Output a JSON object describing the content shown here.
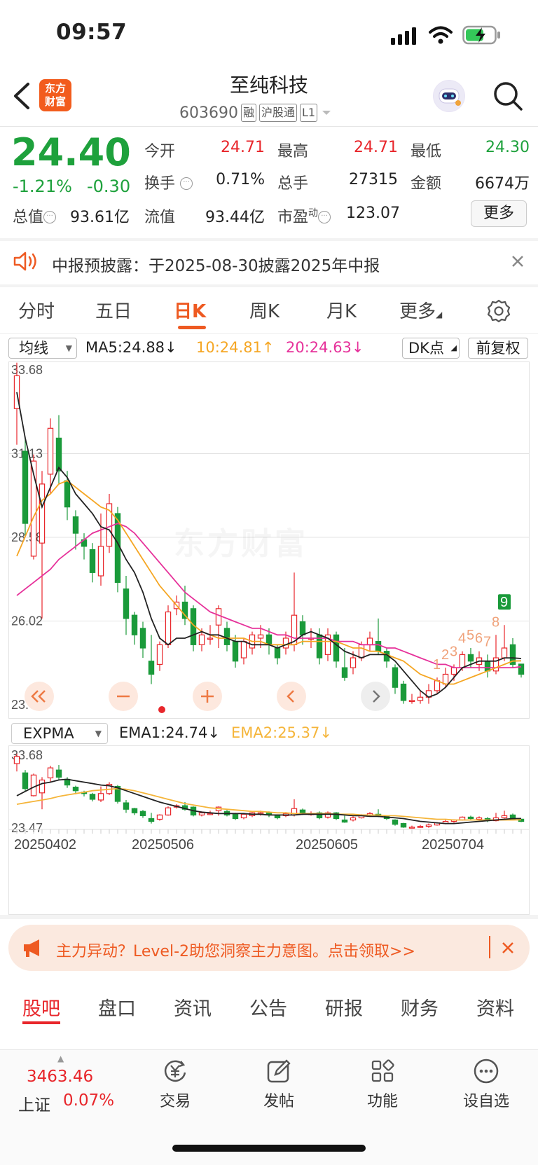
{
  "status": {
    "time": "09:57"
  },
  "header": {
    "logo_line1": "东方",
    "logo_line2": "财富",
    "stock_name": "至纯科技",
    "stock_code": "603690",
    "tags": [
      "融",
      "沪股通",
      "L1"
    ]
  },
  "quote": {
    "price": "24.40",
    "change_pct": "-1.21%",
    "change_abs": "-0.30",
    "rows": [
      [
        {
          "label": "今开",
          "value": "24.71",
          "color": "red"
        },
        {
          "label": "最高",
          "value": "24.71",
          "color": "red"
        },
        {
          "label": "最低",
          "value": "24.30",
          "color": "green"
        }
      ],
      [
        {
          "label": "换手",
          "value": "0.71%",
          "color": "dark"
        },
        {
          "label": "总手",
          "value": "27315",
          "color": "dark"
        },
        {
          "label": "金额",
          "value": "6674万",
          "color": "dark"
        }
      ]
    ],
    "total_value_label": "总值",
    "total_value": "93.61亿",
    "float_value_label": "流值",
    "float_value": "93.44亿",
    "pe_label": "市盈",
    "pe_sup": "动",
    "pe_value": "123.07",
    "more_label": "更多"
  },
  "notice": {
    "text": "中报预披露：于2025-08-30披露2025年中报"
  },
  "tabs": [
    "分时",
    "五日",
    "日K",
    "周K",
    "月K",
    "更多"
  ],
  "active_tab": "日K",
  "main_indicator": {
    "selector": "均线",
    "ma5": "MA5:24.88",
    "ma10": "10:24.81",
    "ma20": "20:24.63",
    "dk": "DK点",
    "adjust": "前复权"
  },
  "sub_indicator": {
    "selector": "EXPMA",
    "ema1": "EMA1:24.74",
    "ema2": "EMA2:25.37"
  },
  "chart_data": {
    "type": "candlestick",
    "main_ylabels": [
      "33.68",
      "31.13",
      "28.58",
      "26.02",
      "23.47"
    ],
    "main_ylim": [
      23.47,
      33.68
    ],
    "sub_ylabels": [
      "33.68",
      "23.47"
    ],
    "xlabels": [
      "20250402",
      "20250506",
      "20250605",
      "20250704"
    ],
    "sequence_labels": [
      "1",
      "2",
      "3",
      "4",
      "5",
      "6",
      "7",
      "8",
      "9"
    ],
    "colors": {
      "up": "#e8262b",
      "down": "#1a9a3a",
      "ma5": "#222222",
      "ma10": "#f5a623",
      "ma20": "#e6319a",
      "ema1": "#222222",
      "ema2": "#f5b53a"
    },
    "candles": [
      [
        32.5,
        33.5,
        31.4,
        33.9
      ],
      [
        31.2,
        29.0,
        28.6,
        31.6
      ],
      [
        28.0,
        30.9,
        27.9,
        31.1
      ],
      [
        28.4,
        30.2,
        26.1,
        30.6
      ],
      [
        30.5,
        31.9,
        29.9,
        32.2
      ],
      [
        31.6,
        30.6,
        30.2,
        32.3
      ],
      [
        30.3,
        29.5,
        29.1,
        30.6
      ],
      [
        29.2,
        28.7,
        28.2,
        29.4
      ],
      [
        28.5,
        28.3,
        27.9,
        28.7
      ],
      [
        28.2,
        27.5,
        27.2,
        28.4
      ],
      [
        27.4,
        28.3,
        27.1,
        29.3
      ],
      [
        28.3,
        29.6,
        28.1,
        29.9
      ],
      [
        29.3,
        27.2,
        26.9,
        29.5
      ],
      [
        27.0,
        26.1,
        25.6,
        27.4
      ],
      [
        26.2,
        25.6,
        25.3,
        26.3
      ],
      [
        25.8,
        25.2,
        24.9,
        26.0
      ],
      [
        24.8,
        24.4,
        24.1,
        25.6
      ],
      [
        24.7,
        25.3,
        24.5,
        25.4
      ],
      [
        25.3,
        26.3,
        25.2,
        26.5
      ],
      [
        26.4,
        26.6,
        26.2,
        26.8
      ],
      [
        26.6,
        26.1,
        25.9,
        27.1
      ],
      [
        26.4,
        25.3,
        25.1,
        26.5
      ],
      [
        25.3,
        25.6,
        25.1,
        25.8
      ],
      [
        25.5,
        25.5,
        25.3,
        25.9
      ],
      [
        25.9,
        26.4,
        25.2,
        26.5
      ],
      [
        25.8,
        25.3,
        25.1,
        26.0
      ],
      [
        25.4,
        24.8,
        24.6,
        25.6
      ],
      [
        24.9,
        25.4,
        24.7,
        25.5
      ],
      [
        25.2,
        25.6,
        25.0,
        25.7
      ],
      [
        25.5,
        25.6,
        25.2,
        25.9
      ],
      [
        25.6,
        25.3,
        25.0,
        25.8
      ],
      [
        25.2,
        24.9,
        24.7,
        25.3
      ],
      [
        25.2,
        25.5,
        25.0,
        25.7
      ],
      [
        25.3,
        26.2,
        25.1,
        27.5
      ],
      [
        26.0,
        25.6,
        25.3,
        26.2
      ],
      [
        25.5,
        25.5,
        25.2,
        25.8
      ],
      [
        25.6,
        24.9,
        24.7,
        25.8
      ],
      [
        25.0,
        25.6,
        24.8,
        25.8
      ],
      [
        25.6,
        24.8,
        24.6,
        25.7
      ],
      [
        24.6,
        24.3,
        24.2,
        25.2
      ],
      [
        24.6,
        24.9,
        24.4,
        25.1
      ],
      [
        24.9,
        25.3,
        24.8,
        25.4
      ],
      [
        25.3,
        25.5,
        25.1,
        25.7
      ],
      [
        25.4,
        25.1,
        25.0,
        26.1
      ],
      [
        25.1,
        24.8,
        24.6,
        25.2
      ],
      [
        24.6,
        24.0,
        23.8,
        24.7
      ],
      [
        24.1,
        23.6,
        23.5,
        24.2
      ],
      [
        23.6,
        23.6,
        23.5,
        23.8
      ],
      [
        23.6,
        23.7,
        23.5,
        23.9
      ],
      [
        23.7,
        23.9,
        23.5,
        24.1
      ],
      [
        23.9,
        24.2,
        23.8,
        24.3
      ],
      [
        24.1,
        24.4,
        24.0,
        24.6
      ],
      [
        24.4,
        24.6,
        24.2,
        24.7
      ],
      [
        24.6,
        25.0,
        24.5,
        25.1
      ],
      [
        25.0,
        24.8,
        24.6,
        25.2
      ],
      [
        24.7,
        24.9,
        24.5,
        25.1
      ],
      [
        24.8,
        24.5,
        24.3,
        25.0
      ],
      [
        24.5,
        24.9,
        24.4,
        25.6
      ],
      [
        24.9,
        25.2,
        24.8,
        25.9
      ],
      [
        25.3,
        24.7,
        24.6,
        25.5
      ],
      [
        24.71,
        24.4,
        24.3,
        24.71
      ]
    ],
    "ma5": [
      33.0,
      31.6,
      30.5,
      29.5,
      30.1,
      30.7,
      30.4,
      29.9,
      29.6,
      29.3,
      28.9,
      28.8,
      28.4,
      27.9,
      27.5,
      26.9,
      26.1,
      25.5,
      25.3,
      25.5,
      25.5,
      25.6,
      25.7,
      25.6,
      25.6,
      25.5,
      25.4,
      25.4,
      25.3,
      25.3,
      25.3,
      25.2,
      25.3,
      25.4,
      25.6,
      25.7,
      25.6,
      25.5,
      25.3,
      25.1,
      25.0,
      24.9,
      25.0,
      25.0,
      25.0,
      24.8,
      24.5,
      24.2,
      23.9,
      23.7,
      23.8,
      24.0,
      24.3,
      24.6,
      24.7,
      24.8,
      24.8,
      24.8,
      24.9,
      24.9,
      24.88
    ],
    "ma10": [
      28.0,
      28.6,
      29.2,
      29.7,
      29.9,
      30.2,
      30.3,
      30.1,
      29.9,
      29.7,
      29.5,
      29.4,
      29.1,
      28.7,
      28.3,
      27.9,
      27.5,
      27.1,
      26.8,
      26.5,
      26.2,
      25.9,
      25.7,
      25.6,
      25.5,
      25.5,
      25.5,
      25.5,
      25.4,
      25.4,
      25.3,
      25.3,
      25.3,
      25.3,
      25.4,
      25.4,
      25.4,
      25.4,
      25.4,
      25.3,
      25.2,
      25.2,
      25.1,
      25.1,
      25.0,
      24.9,
      24.8,
      24.6,
      24.4,
      24.3,
      24.2,
      24.1,
      24.1,
      24.2,
      24.3,
      24.4,
      24.5,
      24.6,
      24.7,
      24.8,
      24.81
    ],
    "ma20": [
      26.8,
      27.0,
      27.2,
      27.4,
      27.6,
      27.9,
      28.1,
      28.3,
      28.5,
      28.7,
      28.8,
      28.9,
      29.0,
      28.9,
      28.7,
      28.4,
      28.1,
      27.8,
      27.5,
      27.2,
      26.9,
      26.7,
      26.5,
      26.3,
      26.2,
      26.1,
      26.0,
      25.9,
      25.8,
      25.8,
      25.7,
      25.6,
      25.6,
      25.5,
      25.5,
      25.5,
      25.5,
      25.5,
      25.4,
      25.4,
      25.4,
      25.3,
      25.3,
      25.3,
      25.2,
      25.2,
      25.1,
      25.0,
      24.9,
      24.8,
      24.7,
      24.7,
      24.6,
      24.6,
      24.6,
      24.6,
      24.6,
      24.6,
      24.6,
      24.6,
      24.63
    ]
  },
  "promo": {
    "text": "主力异动？Level-2助您洞察主力意图。点击领取>>"
  },
  "bottom_tabs": [
    "股吧",
    "盘口",
    "资讯",
    "公告",
    "研报",
    "财务",
    "资料"
  ],
  "index": {
    "value": "3463.46",
    "name": "上证",
    "change": "0.07%"
  },
  "bottom_nav": [
    {
      "label": "交易",
      "icon": "yen-exchange-icon"
    },
    {
      "label": "发帖",
      "icon": "edit-post-icon"
    },
    {
      "label": "功能",
      "icon": "grid-icon"
    },
    {
      "label": "设自选",
      "icon": "dots-circle-icon"
    }
  ]
}
